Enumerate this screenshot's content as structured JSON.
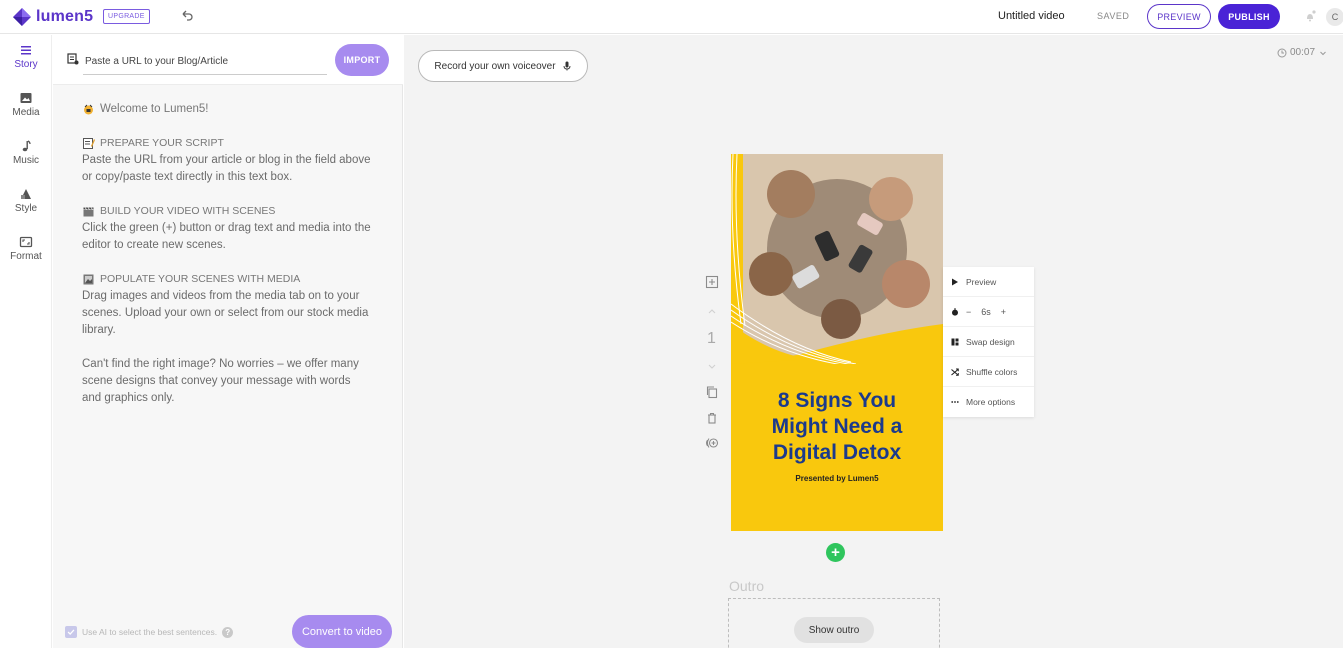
{
  "header": {
    "logo_text": "lumen5",
    "upgrade_label": "UPGRADE",
    "video_title": "Untitled video",
    "saved_label": "SAVED",
    "preview_label": "PREVIEW",
    "publish_label": "PUBLISH",
    "avatar_initial": "C"
  },
  "nav": {
    "items": [
      {
        "label": "Story",
        "icon": "list-icon",
        "active": true
      },
      {
        "label": "Media",
        "icon": "image-icon"
      },
      {
        "label": "Music",
        "icon": "music-note-icon"
      },
      {
        "label": "Style",
        "icon": "palette-icon"
      },
      {
        "label": "Format",
        "icon": "aspect-ratio-icon"
      }
    ]
  },
  "story": {
    "url_placeholder": "Paste a URL to your Blog/Article",
    "import_label": "IMPORT",
    "welcome": "Welcome to Lumen5!",
    "prepare_heading": "PREPARE YOUR SCRIPT",
    "prepare_text": "Paste the URL from your article or blog in the field above or copy/paste text directly in this text box.",
    "build_heading": "BUILD YOUR VIDEO WITH SCENES",
    "build_text": "Click the green (+) button or drag text and media into the editor to create new scenes.",
    "populate_heading": "POPULATE YOUR SCENES WITH MEDIA",
    "populate_text": "Drag images and videos from the media tab on to your scenes. Upload your own or select from our stock media library.",
    "closing_text": "Can't find the right image? No worries – we offer many scene designs that convey your message with words and graphics only.",
    "ai_label": "Use AI to select the best sentences.",
    "help_glyph": "?",
    "convert_label": "Convert to video"
  },
  "canvas": {
    "voiceover_label": "Record your own voiceover",
    "duration": "00:07",
    "scene_number": "1",
    "scene": {
      "title_line1": "8 Signs You",
      "title_line2": "Might Need a",
      "title_line3": "Digital Detox",
      "subtitle": "Presented by Lumen5",
      "background_color": "#f9c80d",
      "title_color": "#1b3a8c"
    },
    "scene_menu": {
      "preview": "Preview",
      "minus": "−",
      "duration": "6s",
      "plus": "+",
      "swap_design": "Swap design",
      "shuffle_colors": "Shuffle colors",
      "more_options": "More options"
    },
    "add_scene_glyph": "+",
    "outro_label": "Outro",
    "show_outro_label": "Show outro"
  },
  "colors": {
    "brand": "#5b35c9",
    "publish": "#4a23d6",
    "button_light_purple": "#a78bef",
    "add_green": "#2fc55d"
  }
}
